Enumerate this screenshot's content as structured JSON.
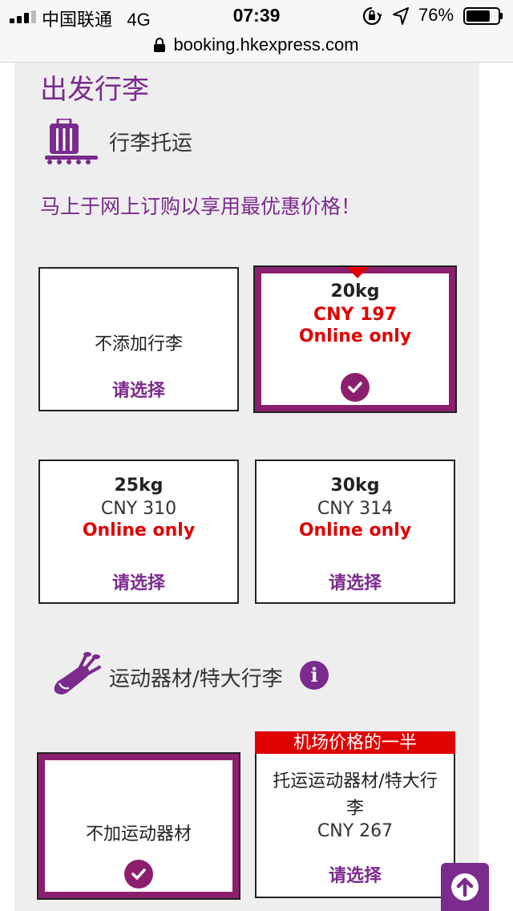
{
  "status_bar": {
    "carrier": "中国联通",
    "network": "4G",
    "time": "07:39",
    "battery": "76%",
    "battery_level": 0.76
  },
  "browser": {
    "url": "booking.hkexpress.com"
  },
  "baggage": {
    "section_title": "出发行李",
    "checked_label": "行李托运",
    "promo_text": "马上于网上订购以享用最优惠价格！",
    "options": [
      {
        "name": "不添加行李",
        "action": "请选择",
        "selected": false
      },
      {
        "weight": "20kg",
        "price": "CNY 197",
        "note": "Online only",
        "selected": true
      },
      {
        "weight": "25kg",
        "price": "CNY 310",
        "note": "Online only",
        "action": "请选择",
        "selected": false
      },
      {
        "weight": "30kg",
        "price": "CNY 314",
        "note": "Online only",
        "action": "请选择",
        "selected": false
      }
    ]
  },
  "sports": {
    "label": "运动器材/特大行李",
    "info_icon": "i",
    "options": [
      {
        "name": "不加运动器材",
        "selected": true
      },
      {
        "banner": "机场价格的一半",
        "name_line1": "托运运动器材/特大行",
        "name_line2": "李",
        "price": "CNY 267",
        "action": "请选择",
        "selected": false
      }
    ]
  },
  "colors": {
    "brand_purple": "#7b2a8e",
    "selected_border": "#8b1f6e",
    "alert_red": "#e00000"
  }
}
